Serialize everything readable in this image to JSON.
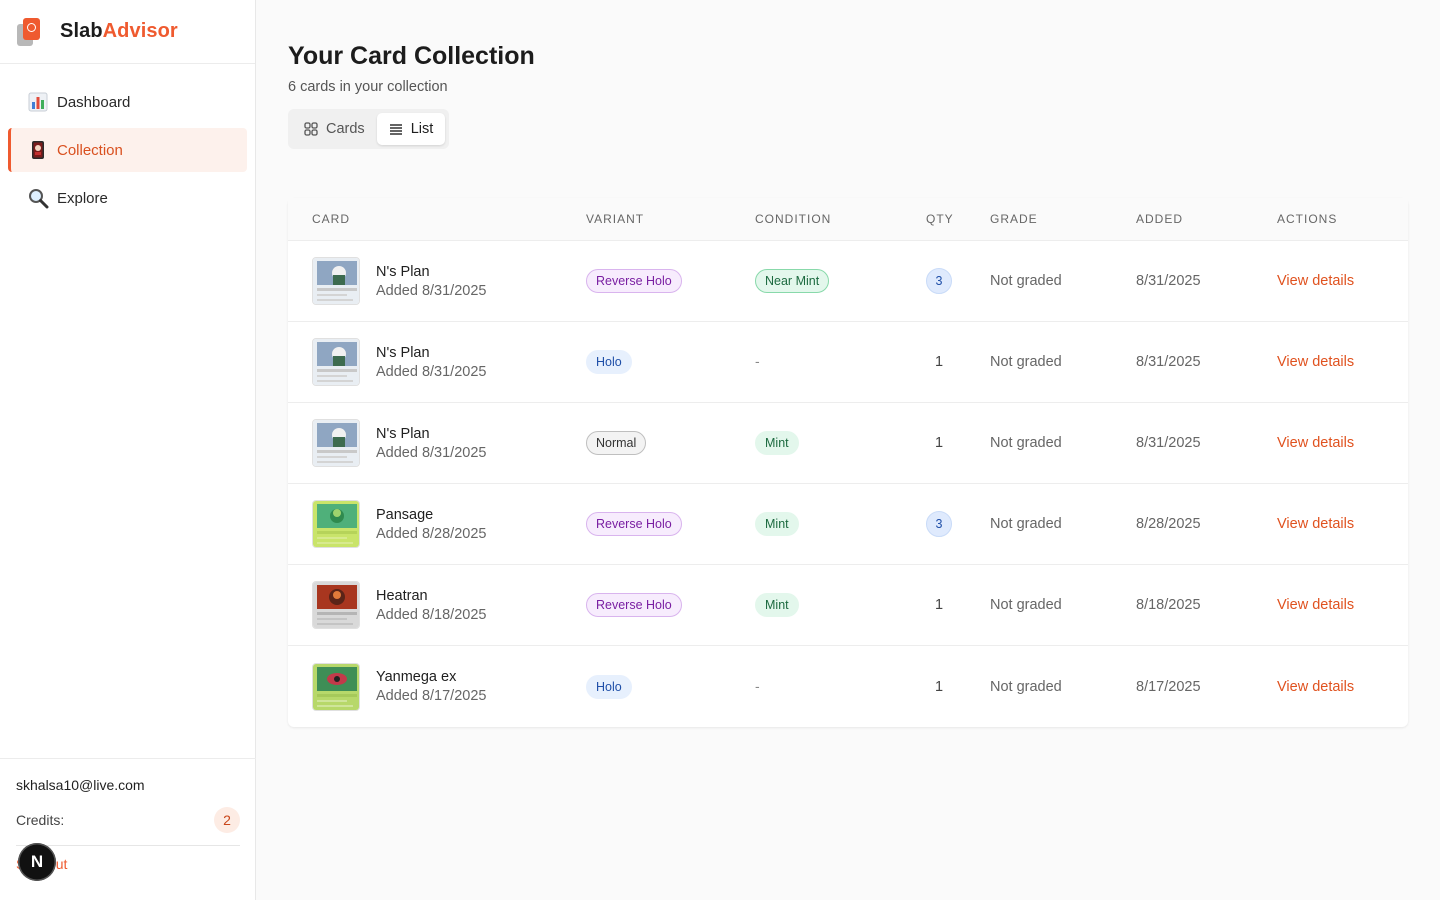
{
  "brand": {
    "name_part1": "Slab",
    "name_part2": "Advisor"
  },
  "nav": {
    "items": [
      {
        "label": "Dashboard",
        "icon": "bar-chart-icon",
        "active": false
      },
      {
        "label": "Collection",
        "icon": "card-icon",
        "active": true
      },
      {
        "label": "Explore",
        "icon": "magnifier-icon",
        "active": false
      }
    ]
  },
  "user": {
    "email": "skhalsa10@live.com",
    "credits_label": "Credits:",
    "credits_value": "2",
    "signout_label": "Sign out",
    "next_badge": "N"
  },
  "page": {
    "title": "Your Card Collection",
    "subtitle": "6 cards in your collection",
    "view_toggle": {
      "cards_label": "Cards",
      "list_label": "List",
      "active": "List"
    }
  },
  "table": {
    "headers": [
      "Card",
      "Variant",
      "Condition",
      "Qty",
      "Grade",
      "Added",
      "Actions"
    ],
    "rows": [
      {
        "name": "N's Plan",
        "sub": "Added 8/31/2025",
        "variant": "Reverse Holo",
        "condition": "Near Mint",
        "qty": "3",
        "grade": "Not graded",
        "added": "8/31/2025",
        "action": "View details"
      },
      {
        "name": "N's Plan",
        "sub": "Added 8/31/2025",
        "variant": "Holo",
        "condition": "-",
        "qty": "1",
        "grade": "Not graded",
        "added": "8/31/2025",
        "action": "View details"
      },
      {
        "name": "N's Plan",
        "sub": "Added 8/31/2025",
        "variant": "Normal",
        "condition": "Mint",
        "qty": "1",
        "grade": "Not graded",
        "added": "8/31/2025",
        "action": "View details"
      },
      {
        "name": "Pansage",
        "sub": "Added 8/28/2025",
        "variant": "Reverse Holo",
        "condition": "Mint",
        "qty": "3",
        "grade": "Not graded",
        "added": "8/28/2025",
        "action": "View details"
      },
      {
        "name": "Heatran",
        "sub": "Added 8/18/2025",
        "variant": "Reverse Holo",
        "condition": "Mint",
        "qty": "1",
        "grade": "Not graded",
        "added": "8/18/2025",
        "action": "View details"
      },
      {
        "name": "Yanmega ex",
        "sub": "Added 8/17/2025",
        "variant": "Holo",
        "condition": "-",
        "qty": "1",
        "grade": "Not graded",
        "added": "8/17/2025",
        "action": "View details"
      }
    ]
  },
  "colors": {
    "accent": "#ef5a2f",
    "sidebar_active_bg": "#fdf1ec"
  }
}
